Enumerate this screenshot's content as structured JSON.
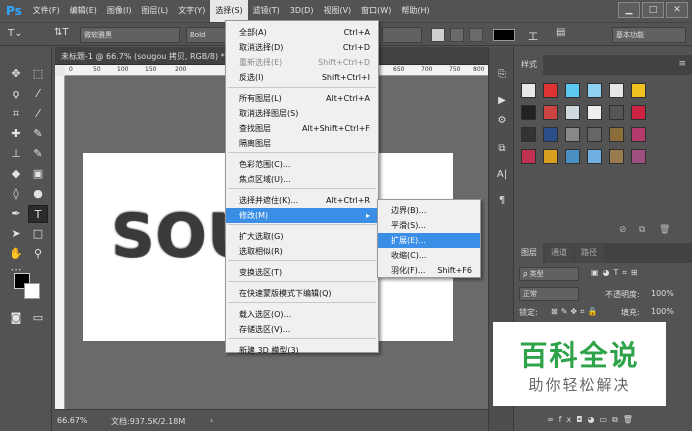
{
  "app": {
    "logo": "Ps"
  },
  "menubar": {
    "items": [
      "文件(F)",
      "编辑(E)",
      "图像(I)",
      "图层(L)",
      "文字(Y)",
      "选择(S)",
      "滤镜(T)",
      "3D(D)",
      "视图(V)",
      "窗口(W)",
      "帮助(H)"
    ],
    "active_index": 5
  },
  "window_controls": {
    "minimize": "▁",
    "maximize": "□",
    "close": "✕"
  },
  "options": {
    "font_family": "微软雅黑",
    "font_style": "Bold",
    "workspace": "基本功能"
  },
  "document": {
    "tab_label": "未标题-1 @ 66.7% (sougou 拷贝, RGB/8) *",
    "ruler_ticks": [
      "0",
      "50",
      "100",
      "150",
      "200",
      "650",
      "700",
      "750",
      "800"
    ],
    "canvas_text": "SOU",
    "zoom": "66.67%",
    "doc_size": "文档:937.5K/2.18M"
  },
  "select_menu": {
    "items": [
      {
        "label": "全部(A)",
        "shortcut": "Ctrl+A",
        "disabled": false
      },
      {
        "label": "取消选择(D)",
        "shortcut": "Ctrl+D",
        "disabled": false
      },
      {
        "label": "重新选择(E)",
        "shortcut": "Shift+Ctrl+D",
        "disabled": true
      },
      {
        "label": "反选(I)",
        "shortcut": "Shift+Ctrl+I",
        "disabled": false
      },
      {
        "label": "所有图层(L)",
        "shortcut": "Alt+Ctrl+A",
        "disabled": false
      },
      {
        "label": "取消选择图层(S)",
        "shortcut": "",
        "disabled": false
      },
      {
        "label": "查找图层",
        "shortcut": "Alt+Shift+Ctrl+F",
        "disabled": false
      },
      {
        "label": "隔离图层",
        "shortcut": "",
        "disabled": false
      },
      {
        "label": "色彩范围(C)...",
        "shortcut": "",
        "disabled": false
      },
      {
        "label": "焦点区域(U)...",
        "shortcut": "",
        "disabled": false
      },
      {
        "label": "选择并遮住(K)...",
        "shortcut": "Alt+Ctrl+R",
        "disabled": false
      },
      {
        "label": "修改(M)",
        "shortcut": "▸",
        "disabled": false
      },
      {
        "label": "扩大选取(G)",
        "shortcut": "",
        "disabled": false
      },
      {
        "label": "选取相似(R)",
        "shortcut": "",
        "disabled": false
      },
      {
        "label": "变换选区(T)",
        "shortcut": "",
        "disabled": false
      },
      {
        "label": "在快速蒙版模式下编辑(Q)",
        "shortcut": "",
        "disabled": false
      },
      {
        "label": "载入选区(O)...",
        "shortcut": "",
        "disabled": false
      },
      {
        "label": "存储选区(V)...",
        "shortcut": "",
        "disabled": false
      },
      {
        "label": "新建 3D 模型(3)",
        "shortcut": "",
        "disabled": false
      }
    ]
  },
  "modify_submenu": {
    "items": [
      {
        "label": "边界(B)...",
        "shortcut": ""
      },
      {
        "label": "平滑(S)...",
        "shortcut": ""
      },
      {
        "label": "扩展(E)...",
        "shortcut": ""
      },
      {
        "label": "收缩(C)...",
        "shortcut": ""
      },
      {
        "label": "羽化(F)...",
        "shortcut": "Shift+F6"
      }
    ],
    "highlight_index": 2
  },
  "styles_panel": {
    "tab": "样式"
  },
  "layers_panel": {
    "tabs": [
      "图层",
      "通道",
      "路径"
    ],
    "filter": "ρ 类型",
    "blend_mode": "正常",
    "opacity_label": "不透明度:",
    "opacity_value": "100%",
    "lock_label": "锁定:",
    "fill_label": "填充:",
    "fill_value": "100%"
  },
  "watermark": {
    "title": "百科全说",
    "subtitle": "助你轻松解决"
  },
  "colors": {
    "accent": "#3a8ee6",
    "watermark_green": "#2ea34a"
  }
}
